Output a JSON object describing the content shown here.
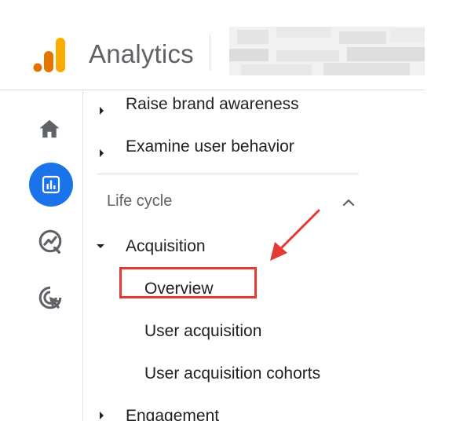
{
  "header": {
    "app_title": "Analytics",
    "logo_colors": [
      "#f9ab00",
      "#e37400"
    ]
  },
  "rail": {
    "items": [
      {
        "icon": "home-icon",
        "active": false
      },
      {
        "icon": "reports-icon",
        "active": true
      },
      {
        "icon": "explore-icon",
        "active": false
      },
      {
        "icon": "advertising-icon",
        "active": false
      }
    ],
    "active_color": "#1a73e8"
  },
  "nav": {
    "items_top": [
      {
        "label": "Raise brand awareness",
        "expanded": false
      },
      {
        "label": "Examine user behavior",
        "expanded": false
      }
    ],
    "section_title": "Life cycle",
    "acquisition": {
      "label": "Acquisition",
      "expanded": true,
      "children": [
        {
          "label": "Overview",
          "highlighted": true
        },
        {
          "label": "User acquisition",
          "highlighted": false
        },
        {
          "label": "User acquisition cohorts",
          "highlighted": false
        }
      ]
    },
    "engagement": {
      "label": "Engagement",
      "expanded": false
    }
  },
  "annotation": {
    "color": "#e53935"
  }
}
